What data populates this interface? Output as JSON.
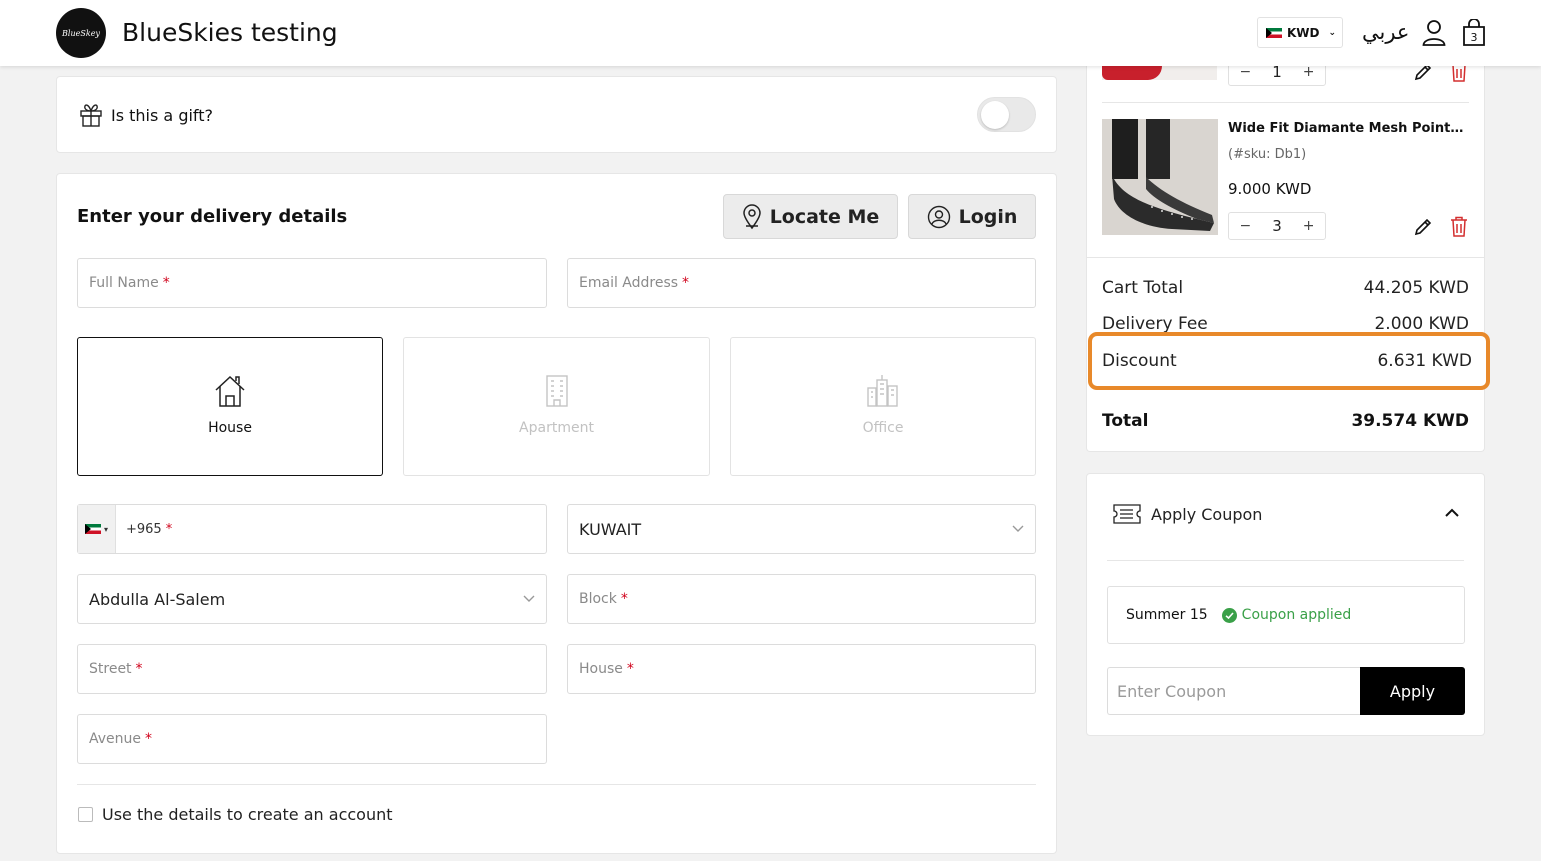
{
  "header": {
    "logo_text": "BlueSkey",
    "site_title": "BlueSkies testing",
    "currency": "KWD",
    "language": "عربي",
    "cart_count": "3"
  },
  "gift": {
    "label": "Is this a gift?",
    "enabled": false
  },
  "delivery": {
    "title": "Enter your delivery details",
    "locate_label": "Locate Me",
    "login_label": "Login",
    "full_name_placeholder": "Full Name",
    "email_placeholder": "Email Address",
    "address_types": [
      {
        "label": "House",
        "selected": true,
        "icon": "house-icon"
      },
      {
        "label": "Apartment",
        "selected": false,
        "icon": "apartment-icon"
      },
      {
        "label": "Office",
        "selected": false,
        "icon": "office-icon"
      }
    ],
    "phone_code": "+965",
    "country": "KUWAIT",
    "area": "Abdulla Al-Salem",
    "block_placeholder": "Block",
    "street_placeholder": "Street",
    "house_placeholder": "House",
    "avenue_placeholder": "Avenue",
    "required_mark": "*",
    "create_account_label": "Use the details to create an account",
    "create_account_checked": false
  },
  "cart": {
    "items": [
      {
        "qty": "1"
      },
      {
        "name": "Wide Fit Diamante Mesh Pointed Toe Slingback",
        "sku": "(#sku: Db1)",
        "price": "9.000 KWD",
        "qty": "3"
      }
    ],
    "qty_minus": "−",
    "qty_plus": "+",
    "cart_total_label": "Cart Total",
    "cart_total_value": "44.205 KWD",
    "delivery_fee_label": "Delivery Fee",
    "delivery_fee_value": "2.000 KWD",
    "discount_label": "Discount",
    "discount_value": "6.631 KWD",
    "total_label": "Total",
    "total_value": "39.574 KWD"
  },
  "coupon": {
    "title": "Apply Coupon",
    "applied_code": "Summer 15",
    "applied_status": "Coupon applied",
    "input_placeholder": "Enter Coupon",
    "apply_label": "Apply"
  },
  "colors": {
    "highlight": "#e8892a",
    "success": "#3aa048",
    "required": "#d0021b",
    "delete": "#d32f2f"
  }
}
